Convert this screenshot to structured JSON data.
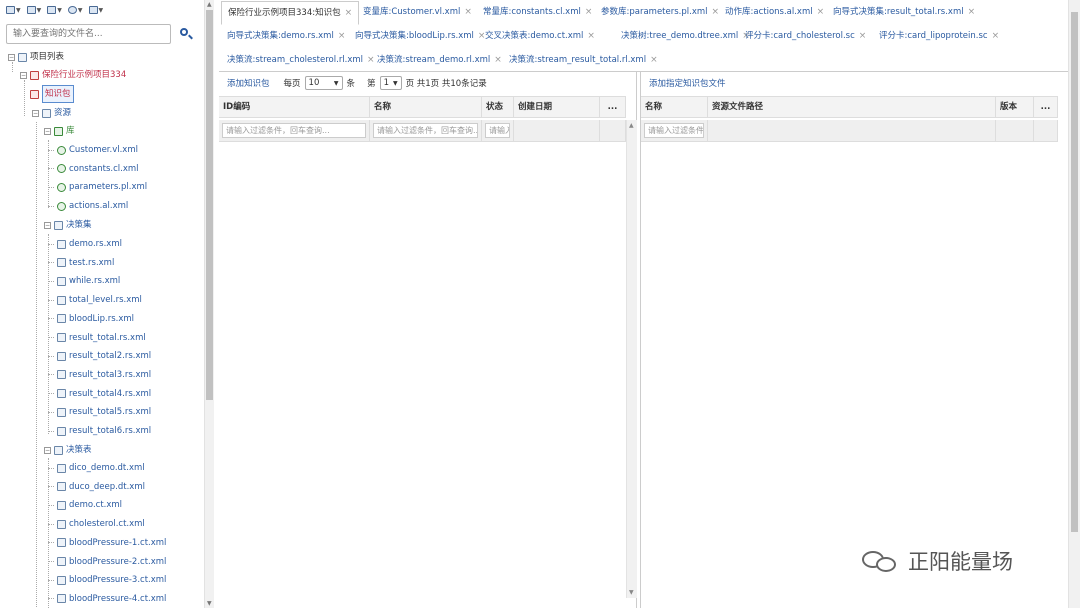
{
  "toolbar": {
    "buttons": [
      {
        "name": "monitor-menu-button",
        "icon": "monitor-icon"
      },
      {
        "name": "list-menu-button",
        "icon": "list-icon"
      },
      {
        "name": "grid-menu-button",
        "icon": "grid-icon"
      },
      {
        "name": "settings-menu-button",
        "icon": "globe-gear-icon"
      },
      {
        "name": "refresh-menu-button",
        "icon": "refresh-icon"
      }
    ]
  },
  "search": {
    "placeholder": "输入要查询的文件名..."
  },
  "tree": {
    "root": "项目列表",
    "project": "保险行业示例项目334",
    "knowledge_pkg": "知识包",
    "resources": "资源",
    "library": "库",
    "library_files": [
      "Customer.vl.xml",
      "constants.cl.xml",
      "parameters.pl.xml",
      "actions.al.xml"
    ],
    "ruleset": "决策集",
    "ruleset_files": [
      "demo.rs.xml",
      "test.rs.xml",
      "while.rs.xml",
      "total_level.rs.xml",
      "bloodLip.rs.xml",
      "result_total.rs.xml",
      "result_total2.rs.xml",
      "result_total3.rs.xml",
      "result_total4.rs.xml",
      "result_total5.rs.xml",
      "result_total6.rs.xml"
    ],
    "dtable": "决策表",
    "dtable_files": [
      "dico_demo.dt.xml",
      "duco_deep.dt.xml",
      "demo.ct.xml",
      "cholesterol.ct.xml",
      "bloodPressure-1.ct.xml",
      "bloodPressure-2.ct.xml",
      "bloodPressure-3.ct.xml",
      "bloodPressure-4.ct.xml"
    ]
  },
  "tabs": [
    {
      "label": "保险行业示例项目334:知识包",
      "active": true
    },
    {
      "label": "变量库:Customer.vl.xml"
    },
    {
      "label": "常量库:constants.cl.xml"
    },
    {
      "label": "参数库:parameters.pl.xml"
    },
    {
      "label": "动作库:actions.al.xml"
    },
    {
      "label": "向导式决策集:result_total.rs.xml"
    },
    {
      "label": "向导式决策集:demo.rs.xml"
    },
    {
      "label": "向导式决策集:bloodLip.rs.xml"
    },
    {
      "label": "交叉决策表:demo.ct.xml"
    },
    {
      "label": "决策树:tree_demo.dtree.xml"
    },
    {
      "label": "评分卡:card_cholesterol.sc"
    },
    {
      "label": "评分卡:card_lipoprotein.sc"
    },
    {
      "label": "决策流:stream_cholesterol.rl.xml"
    },
    {
      "label": "决策流:stream_demo.rl.xml"
    },
    {
      "label": "决策流:stream_result_total.rl.xml"
    }
  ],
  "left_pane": {
    "add_link": "添加知识包",
    "per_page_label": "每页",
    "per_page_value": "10",
    "per_page_unit": "条",
    "page_label": "第",
    "page_value": "1",
    "page_info": "页 共1页 共10条记录",
    "columns": [
      "ID编码",
      "名称",
      "状态",
      "创建日期",
      "..."
    ],
    "filter_placeholder": "请输入过滤条件，回车查询..."
  },
  "right_pane": {
    "add_link": "添加指定知识包文件",
    "columns": [
      "名称",
      "资源文件路径",
      "版本",
      "..."
    ],
    "filter_placeholder": "请输入过滤条件..."
  },
  "watermark": {
    "text": "正阳能量场"
  }
}
